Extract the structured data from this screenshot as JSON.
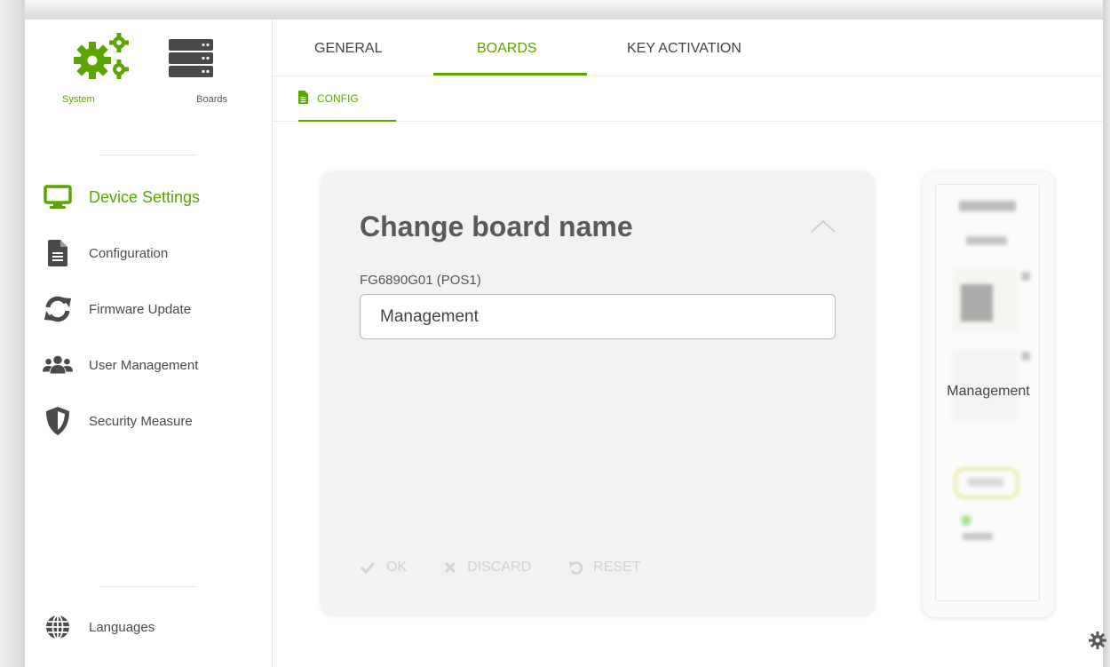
{
  "sidebar": {
    "top": {
      "system_label": "System",
      "boards_label": "Boards"
    },
    "items": [
      {
        "label": "Device Settings",
        "icon": "monitor-icon",
        "active": true
      },
      {
        "label": "Configuration",
        "icon": "document-icon",
        "active": false
      },
      {
        "label": "Firmware Update",
        "icon": "refresh-icon",
        "active": false
      },
      {
        "label": "User Management",
        "icon": "users-icon",
        "active": false
      },
      {
        "label": "Security Measure",
        "icon": "shield-icon",
        "active": false
      }
    ],
    "languages_label": "Languages"
  },
  "tabs": [
    {
      "label": "GENERAL",
      "active": false
    },
    {
      "label": "BOARDS",
      "active": true
    },
    {
      "label": "KEY ACTIVATION",
      "active": false
    }
  ],
  "subtab": {
    "label": "CONFIG"
  },
  "card": {
    "title": "Change board name",
    "field_label": "FG6890G01 (POS1)",
    "field_value": "Management",
    "actions": {
      "ok": "OK",
      "discard": "DISCARD",
      "reset": "RESET"
    }
  },
  "board_preview": {
    "name": "Management"
  },
  "colors": {
    "accent": "#5aa500",
    "text": "#444444",
    "disabled": "#d2d2d2"
  }
}
